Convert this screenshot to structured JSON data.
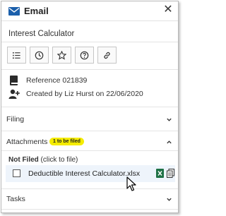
{
  "header": {
    "title": "Email",
    "close_symbol": "✕",
    "icon": "mail-icon"
  },
  "subject": "Interest Calculator",
  "toolbar": {
    "buttons": [
      {
        "name": "list-icon"
      },
      {
        "name": "clock-icon"
      },
      {
        "name": "star-icon"
      },
      {
        "name": "help-icon"
      },
      {
        "name": "link-icon"
      }
    ]
  },
  "info": {
    "reference": "Reference 021839",
    "created": "Created by Liz Hurst on 22/06/2020"
  },
  "sections": {
    "filing": "Filing",
    "attachments": "Attachments",
    "attachments_badge": "1 to be filed",
    "tasks": "Tasks"
  },
  "attachments": {
    "not_filed_label": "Not Filed",
    "not_filed_hint": " (click to file)",
    "files": [
      {
        "name": "Deductible Interest Calculator.xlsx"
      }
    ]
  },
  "colors": {
    "accent": "#1b5fab",
    "badge": "#f5ec00",
    "excel": "#1e7145",
    "row_bg": "#eef4fb"
  }
}
